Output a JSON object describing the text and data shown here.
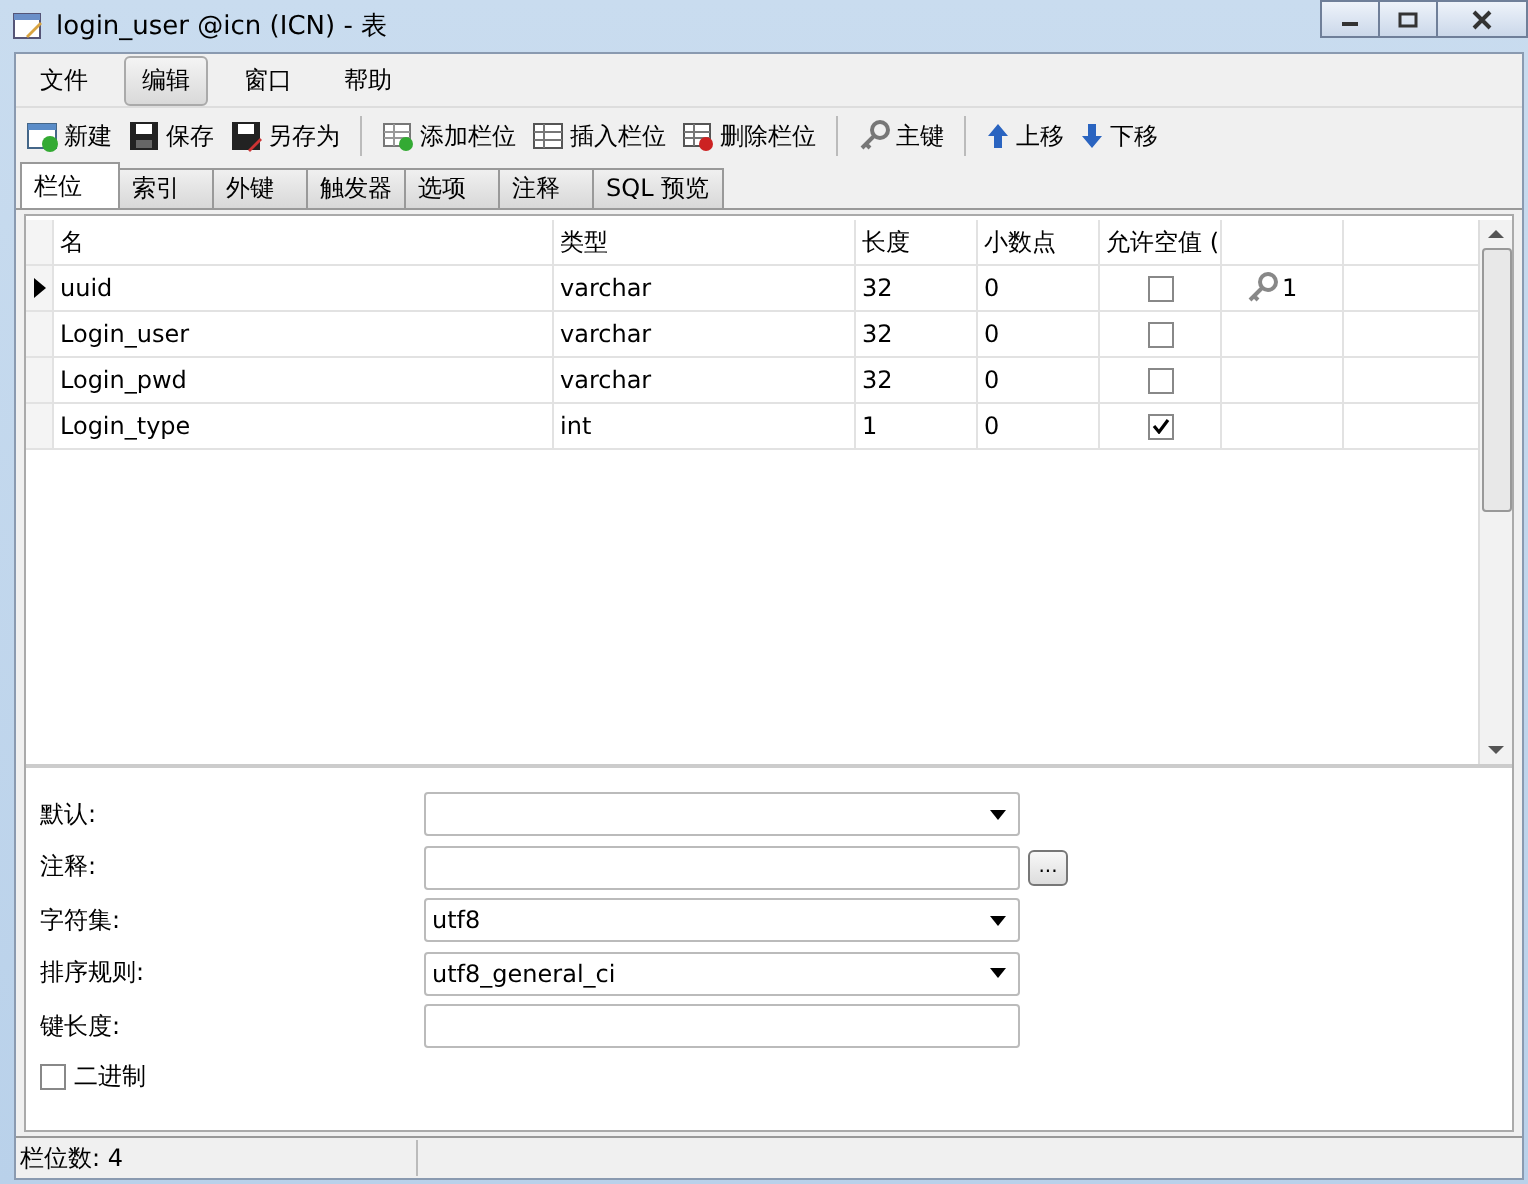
{
  "window": {
    "title": "login_user @icn (ICN) - 表"
  },
  "menu": [
    {
      "label": "文件",
      "selected": false
    },
    {
      "label": "编辑",
      "selected": true
    },
    {
      "label": "窗口",
      "selected": false
    },
    {
      "label": "帮助",
      "selected": false
    }
  ],
  "toolbar": [
    [
      {
        "label": "新建",
        "kind": "new"
      },
      {
        "label": "保存",
        "kind": "save"
      },
      {
        "label": "另存为",
        "kind": "saveas"
      }
    ],
    [
      {
        "label": "添加栏位",
        "kind": "add"
      },
      {
        "label": "插入栏位",
        "kind": "insert"
      },
      {
        "label": "删除栏位",
        "kind": "delete"
      }
    ],
    [
      {
        "label": "主键",
        "kind": "key"
      }
    ],
    [
      {
        "label": "上移",
        "kind": "up"
      },
      {
        "label": "下移",
        "kind": "down"
      }
    ]
  ],
  "tabs": [
    {
      "label": "栏位",
      "selected": true
    },
    {
      "label": "索引",
      "selected": false
    },
    {
      "label": "外键",
      "selected": false
    },
    {
      "label": "触发器",
      "selected": false
    },
    {
      "label": "选项",
      "selected": false
    },
    {
      "label": "注释",
      "selected": false
    },
    {
      "label": "SQL 预览",
      "selected": false
    }
  ],
  "table": {
    "columns": [
      "名",
      "类型",
      "长度",
      "小数点",
      "允许空值 ("
    ],
    "rows": [
      {
        "name": "uuid",
        "type": "varchar",
        "length": "32",
        "decimals": "0",
        "nullable": false,
        "selected": true,
        "key": "1"
      },
      {
        "name": "Login_user",
        "type": "varchar",
        "length": "32",
        "decimals": "0",
        "nullable": false,
        "selected": false
      },
      {
        "name": "Login_pwd",
        "type": "varchar",
        "length": "32",
        "decimals": "0",
        "nullable": false,
        "selected": false
      },
      {
        "name": "Login_type",
        "type": "int",
        "length": "1",
        "decimals": "0",
        "nullable": true,
        "selected": false
      }
    ]
  },
  "properties": [
    {
      "label": "默认:",
      "kind": "dropdown"
    },
    {
      "label": "注释:",
      "kind": "text",
      "button": "..."
    },
    {
      "label": "字符集:",
      "value": "utf8",
      "kind": "dropdown"
    },
    {
      "label": "排序规则:",
      "value": "utf8_general_ci",
      "kind": "dropdown"
    },
    {
      "label": "键长度:",
      "kind": "text"
    }
  ],
  "binary": {
    "label": "二进制",
    "checked": false
  },
  "status_bar": "栏位数: 4"
}
